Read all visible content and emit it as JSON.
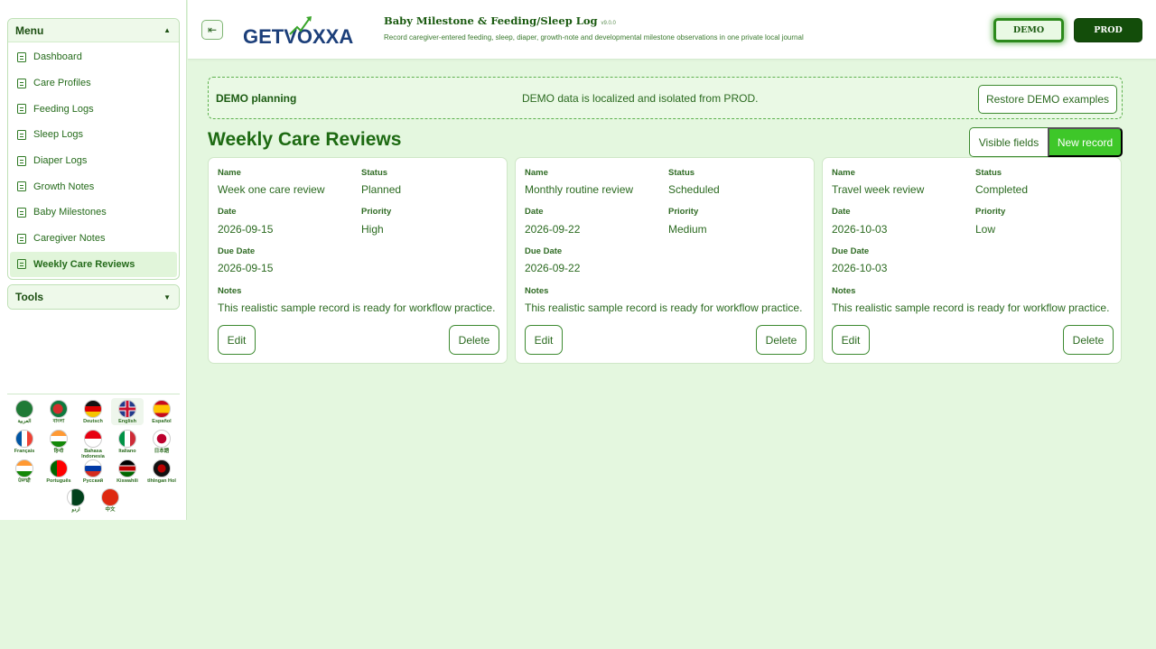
{
  "sidebar": {
    "menu_title": "Menu",
    "menu_items": [
      {
        "label": "Dashboard"
      },
      {
        "label": "Care Profiles"
      },
      {
        "label": "Feeding Logs"
      },
      {
        "label": "Sleep Logs"
      },
      {
        "label": "Diaper Logs"
      },
      {
        "label": "Growth Notes"
      },
      {
        "label": "Baby Milestones"
      },
      {
        "label": "Caregiver Notes"
      },
      {
        "label": "Weekly Care Reviews",
        "active": true
      }
    ],
    "tools_title": "Tools",
    "languages": [
      {
        "label": "العربية"
      },
      {
        "label": "বাংলা"
      },
      {
        "label": "Deutsch"
      },
      {
        "label": "English",
        "selected": true
      },
      {
        "label": "Español"
      },
      {
        "label": "Français"
      },
      {
        "label": "हिन्दी"
      },
      {
        "label": "Bahasa Indonesia"
      },
      {
        "label": "Italiano"
      },
      {
        "label": "日本語"
      },
      {
        "label": "ਪੰਜਾਬੀ"
      },
      {
        "label": "Português"
      },
      {
        "label": "Русский"
      },
      {
        "label": "Kiswahili"
      },
      {
        "label": "tlhIngan Hol"
      },
      {
        "label": "اردو"
      },
      {
        "label": "中文"
      }
    ]
  },
  "header": {
    "collapse_icon": "sidebar-collapse-icon",
    "logo_text": "GETVOXXA",
    "title": "Baby Milestone & Feeding/Sleep Log",
    "version": "v9.0.0",
    "subtitle": "Record caregiver-entered feeding, sleep, diaper, growth-note and developmental milestone observations in one private local journal",
    "demo_label": "DEMO",
    "prod_label": "PROD"
  },
  "banner": {
    "title": "DEMO planning",
    "message": "DEMO data is localized and isolated from PROD.",
    "restore_label": "Restore DEMO examples"
  },
  "main": {
    "title": "Weekly Care Reviews",
    "visible_fields_label": "Visible fields",
    "new_record_label": "New record",
    "field_labels": {
      "name": "Name",
      "status": "Status",
      "date": "Date",
      "priority": "Priority",
      "due_date": "Due Date",
      "notes": "Notes"
    },
    "edit_label": "Edit",
    "delete_label": "Delete",
    "records": [
      {
        "name": "Week one care review",
        "status": "Planned",
        "date": "2026-09-15",
        "priority": "High",
        "due_date": "2026-09-15",
        "notes": "This realistic sample record is ready for workflow practice."
      },
      {
        "name": "Monthly routine review",
        "status": "Scheduled",
        "date": "2026-09-22",
        "priority": "Medium",
        "due_date": "2026-09-22",
        "notes": "This realistic sample record is ready for workflow practice."
      },
      {
        "name": "Travel week review",
        "status": "Completed",
        "date": "2026-10-03",
        "priority": "Low",
        "due_date": "2026-10-03",
        "notes": "This realistic sample record is ready for workflow practice."
      }
    ]
  },
  "colors": {
    "accent": "#3ec729",
    "dark_green": "#134d0a",
    "page_bg": "#e4f7df"
  }
}
